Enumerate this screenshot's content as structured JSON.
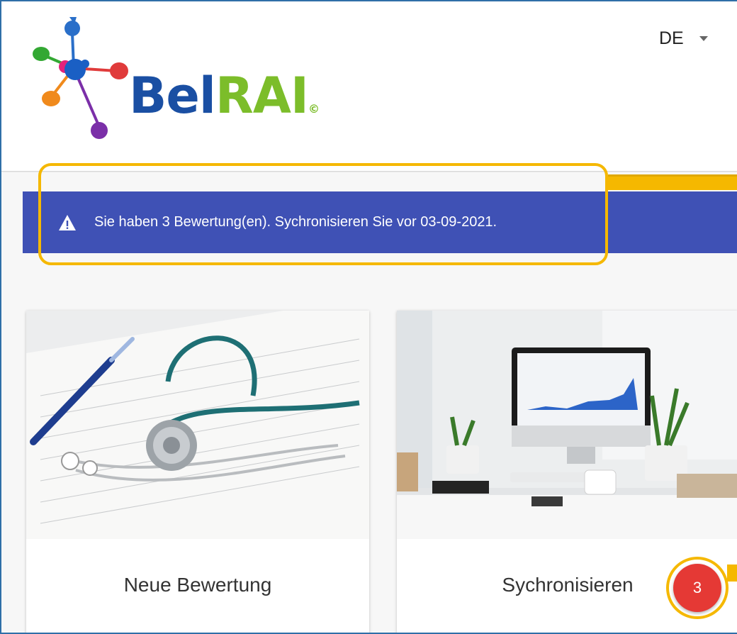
{
  "header": {
    "logo": {
      "text_bel": "Bel",
      "text_rai": "RAI",
      "text_reg": "©"
    },
    "language": {
      "selected": "DE"
    }
  },
  "alert": {
    "icon": "warning-icon",
    "message": "Sie haben 3 Bewertung(en). Sychronisieren Sie vor 03-09-2021."
  },
  "cards": [
    {
      "label": "Neue Bewertung",
      "image": "stethoscope-on-papers"
    },
    {
      "label": "Sychronisieren",
      "image": "desk-with-monitor",
      "badge_count": "3"
    }
  ],
  "colors": {
    "alert_bg": "#3f51b5",
    "highlight": "#f5b800",
    "badge": "#e53935",
    "logo_blue": "#1a4fa3",
    "logo_green": "#7cbd2a"
  }
}
